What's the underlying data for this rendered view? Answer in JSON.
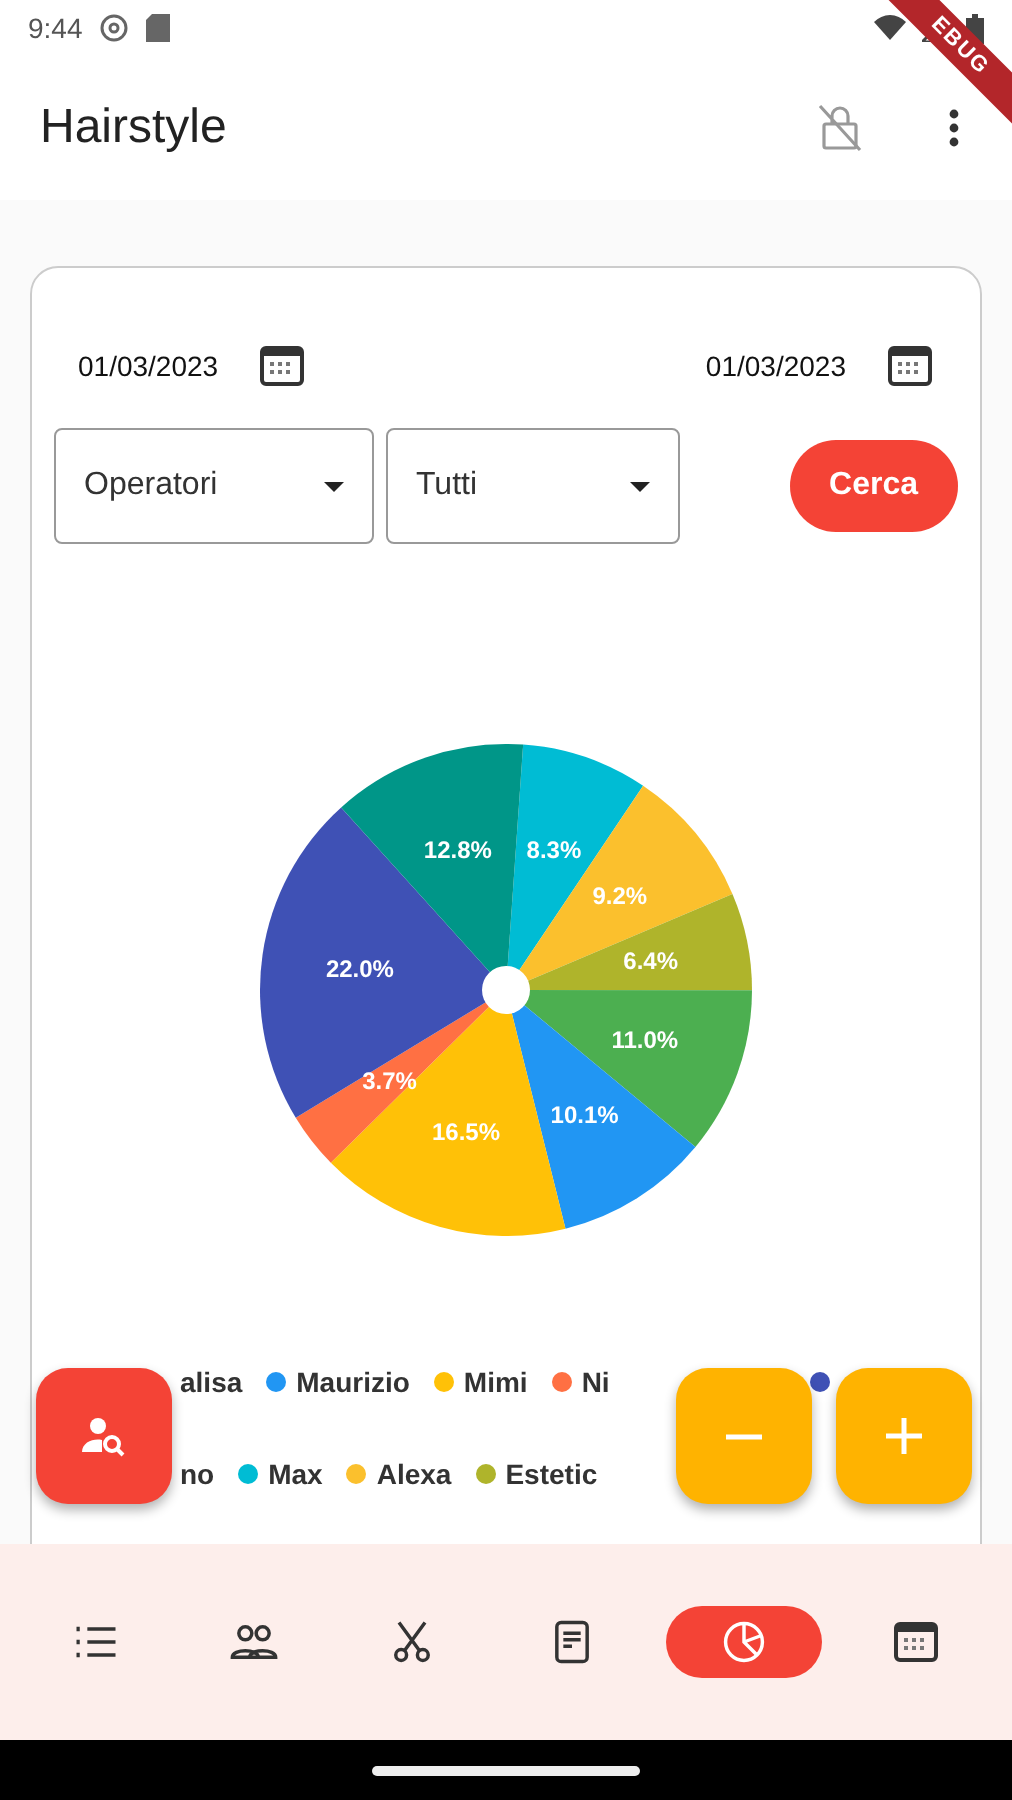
{
  "status_bar": {
    "time": "9:44"
  },
  "debug_banner": "EBUG",
  "app_bar": {
    "title": "Hairstyle"
  },
  "filters": {
    "date_from": "01/03/2023",
    "date_to": "01/03/2023",
    "dropdowns": [
      {
        "value": "Operatori"
      },
      {
        "value": "Tutti"
      }
    ],
    "search_button": "Cerca"
  },
  "chart_data": {
    "type": "pie",
    "values": [
      8.3,
      9.2,
      6.4,
      11.0,
      10.1,
      16.5,
      3.7,
      22.0,
      12.8
    ],
    "value_labels": [
      "8.3%",
      "9.2%",
      "6.4%",
      "11.0%",
      "10.1%",
      "16.5%",
      "3.7%",
      "22.0%",
      "12.8%"
    ],
    "colors": [
      "#00bcd4",
      "#fbc02d",
      "#afb42b",
      "#4caf50",
      "#2196f3",
      "#ffc107",
      "#ff7043",
      "#3f51b5",
      "#009688"
    ]
  },
  "legend": [
    [
      {
        "label": "alisa"
      },
      {
        "label": "Maurizio",
        "color": "#2196f3"
      },
      {
        "label": "Mimi",
        "color": "#ffc107"
      },
      {
        "label": "Ni",
        "color": "#ff7043"
      },
      {
        "color": "#3f51b5"
      }
    ],
    [
      {
        "label": "no"
      },
      {
        "label": "Max",
        "color": "#00bcd4"
      },
      {
        "label": "Alexa",
        "color": "#fbc02d"
      },
      {
        "label": "Estetic",
        "color": "#afb42b"
      }
    ]
  ],
  "bottom_nav": [
    {
      "kind": "list",
      "selected": false
    },
    {
      "kind": "people",
      "selected": false
    },
    {
      "kind": "scissors",
      "selected": false
    },
    {
      "kind": "document",
      "selected": false
    },
    {
      "kind": "chart",
      "selected": true
    },
    {
      "kind": "calendar",
      "selected": false
    }
  ]
}
